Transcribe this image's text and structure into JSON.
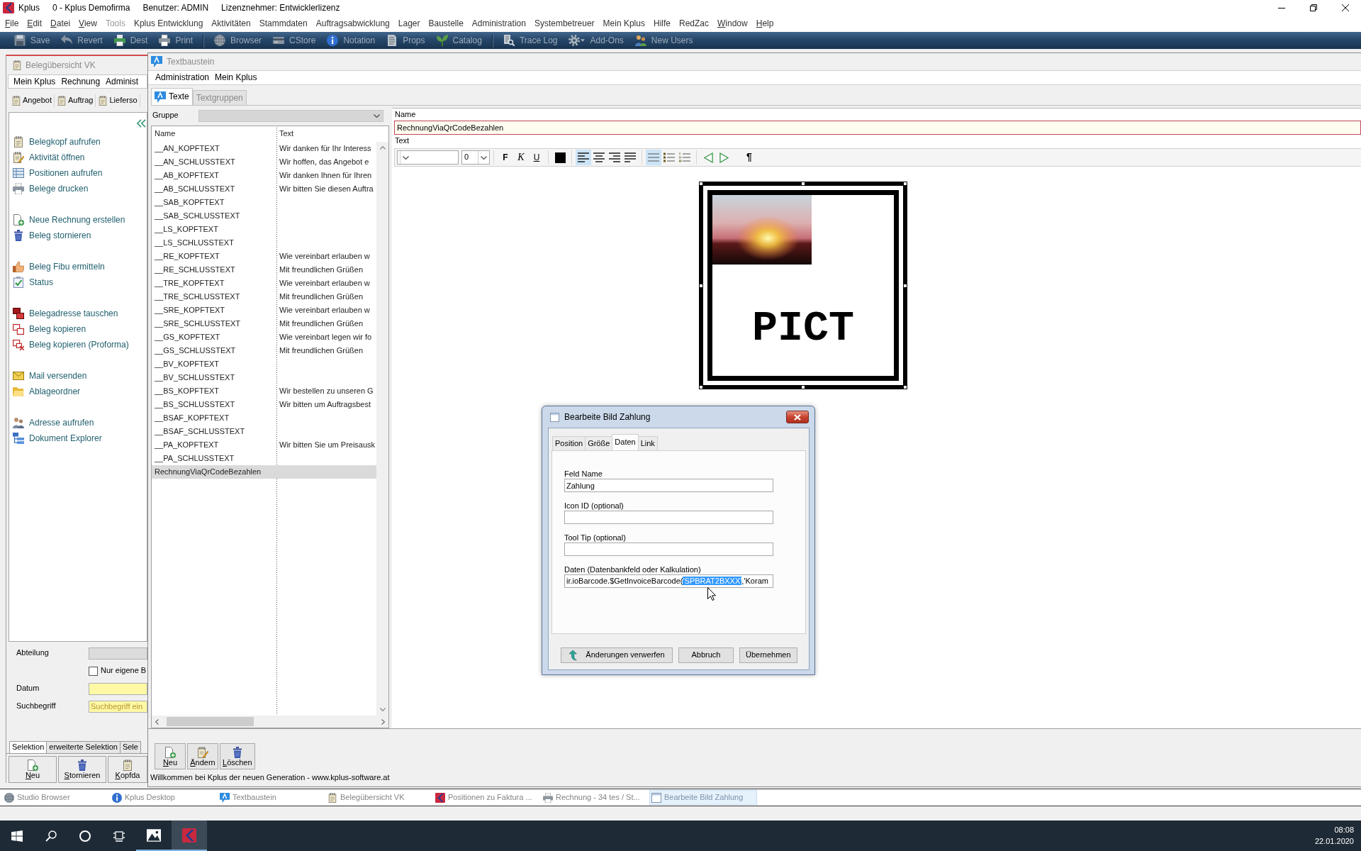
{
  "window": {
    "app_name": "Kplus",
    "title": "0 - Kplus Demofirma",
    "user": "Benutzer: ADMIN",
    "license": "Lizenznehmer: Entwicklerlizenz"
  },
  "menu_bar": [
    {
      "label": "File",
      "dimmed": false,
      "mnemonic": true
    },
    {
      "label": "Edit",
      "dimmed": false,
      "mnemonic": true
    },
    {
      "label": "Datei",
      "dimmed": false,
      "mnemonic": true
    },
    {
      "label": "View",
      "dimmed": false,
      "mnemonic": true
    },
    {
      "label": "Tools",
      "dimmed": true,
      "mnemonic": false
    },
    {
      "label": "Kplus Entwicklung",
      "dimmed": false,
      "mnemonic": false
    },
    {
      "label": "Aktivitäten",
      "dimmed": false,
      "mnemonic": false
    },
    {
      "label": "Stammdaten",
      "dimmed": false,
      "mnemonic": false
    },
    {
      "label": "Auftragsabwicklung",
      "dimmed": false,
      "mnemonic": false
    },
    {
      "label": "Lager",
      "dimmed": false,
      "mnemonic": false
    },
    {
      "label": "Baustelle",
      "dimmed": false,
      "mnemonic": false
    },
    {
      "label": "Administration",
      "dimmed": false,
      "mnemonic": false
    },
    {
      "label": "Systembetreuer",
      "dimmed": false,
      "mnemonic": false
    },
    {
      "label": "Mein Kplus",
      "dimmed": false,
      "mnemonic": false
    },
    {
      "label": "Hilfe",
      "dimmed": false,
      "mnemonic": false
    },
    {
      "label": "RedZac",
      "dimmed": false,
      "mnemonic": false
    },
    {
      "label": "Window",
      "dimmed": false,
      "mnemonic": true
    },
    {
      "label": "Help",
      "dimmed": false,
      "mnemonic": true
    }
  ],
  "toolbar": {
    "groups": [
      {
        "items": [
          {
            "label": "Save",
            "dropdown": false
          },
          {
            "label": "Revert",
            "dropdown": false
          },
          {
            "label": "Dest",
            "dropdown": false
          },
          {
            "label": "Print",
            "dropdown": false
          }
        ]
      },
      {
        "items": [
          {
            "label": "Browser",
            "dropdown": false
          },
          {
            "label": "CStore",
            "dropdown": false
          },
          {
            "label": "Notation",
            "dropdown": false
          },
          {
            "label": "Props",
            "dropdown": false
          },
          {
            "label": "Catalog",
            "dropdown": false
          }
        ]
      },
      {
        "items": [
          {
            "label": "Trace Log",
            "dropdown": false
          },
          {
            "label": "Add-Ons",
            "dropdown": true
          },
          {
            "label": "New Users",
            "dropdown": false
          }
        ]
      }
    ]
  },
  "document_overview": {
    "title": "Belegübersicht VK",
    "menu": [
      "Mein Kplus",
      "Rechnung",
      "Administ"
    ],
    "toolbar": [
      "Angebot",
      "Auftrag",
      "Lieferso"
    ],
    "action_groups": [
      {
        "items": [
          "Belegkopf aufrufen",
          "Aktivität öffnen",
          "Positionen aufrufen",
          "Belege drucken"
        ]
      },
      {
        "items": [
          "Neue Rechnung erstellen",
          "Beleg stornieren"
        ]
      },
      {
        "items": [
          "Beleg Fibu ermitteln",
          "Status"
        ]
      },
      {
        "items": [
          "Belegadresse tauschen",
          "Beleg kopieren",
          "Beleg kopieren (Proforma)"
        ]
      },
      {
        "items": [
          "Mail versenden",
          "Ablageordner"
        ]
      },
      {
        "items": [
          "Adresse aufrufen",
          "Dokument Explorer"
        ]
      }
    ],
    "department_label": "Abteilung",
    "own_only": {
      "label": "Nur eigene B",
      "checked": false
    },
    "date_label": "Datum",
    "search": {
      "label": "Suchbegriff",
      "placeholder": "Suchbegriff ein"
    },
    "tabs": [
      {
        "label": "Selektion",
        "selected": true
      },
      {
        "label": "erweiterte Selektion",
        "selected": false
      },
      {
        "label": "Sele",
        "selected": false
      }
    ],
    "buttons": [
      "Neu",
      "Stornieren",
      "Kopfda"
    ]
  },
  "text_modules": {
    "title": "Textbaustein",
    "menu": [
      "Administration",
      "Mein Kplus"
    ],
    "tabs": [
      {
        "label": "Texte",
        "selected": true
      },
      {
        "label": "Textgruppen",
        "selected": false
      }
    ],
    "group_label": "Gruppe",
    "table": {
      "columns": [
        "Name",
        "Text"
      ],
      "rows": [
        {
          "name": "__AN_KOPFTEXT",
          "text": "Wir danken für Ihr Interess",
          "selected": false
        },
        {
          "name": "__AN_SCHLUSSTEXT",
          "text": "Wir hoffen, das Angebot e",
          "selected": false
        },
        {
          "name": "__AB_KOPFTEXT",
          "text": "Wir danken Ihnen für Ihren",
          "selected": false
        },
        {
          "name": "__AB_SCHLUSSTEXT",
          "text": "Wir bitten Sie diesen Auftra",
          "selected": false
        },
        {
          "name": "__SAB_KOPFTEXT",
          "selected": false
        },
        {
          "name": "__SAB_SCHLUSSTEXT",
          "selected": false
        },
        {
          "name": "__LS_KOPFTEXT",
          "selected": false
        },
        {
          "name": "__LS_SCHLUSSTEXT",
          "selected": false
        },
        {
          "name": "__RE_KOPFTEXT",
          "text": "Wie vereinbart erlauben w",
          "selected": false
        },
        {
          "name": "__RE_SCHLUSSTEXT",
          "text": "Mit freundlichen Grüßen",
          "selected": false
        },
        {
          "name": "__TRE_KOPFTEXT",
          "text": "Wie vereinbart erlauben w",
          "selected": false
        },
        {
          "name": "__TRE_SCHLUSSTEXT",
          "text": "Mit freundlichen Grüßen",
          "selected": false
        },
        {
          "name": "__SRE_KOPFTEXT",
          "text": "Wie vereinbart erlauben w",
          "selected": false
        },
        {
          "name": "__SRE_SCHLUSSTEXT",
          "text": "Mit freundlichen Grüßen",
          "selected": false
        },
        {
          "name": "__GS_KOPFTEXT",
          "text": "Wie vereinbart legen wir fo",
          "selected": false
        },
        {
          "name": "__GS_SCHLUSSTEXT",
          "text": "Mit freundlichen Grüßen",
          "selected": false
        },
        {
          "name": "__BV_KOPFTEXT",
          "selected": false
        },
        {
          "name": "__BV_SCHLUSSTEXT",
          "selected": false
        },
        {
          "name": "__BS_KOPFTEXT",
          "text": "Wir bestellen zu unseren G",
          "selected": false
        },
        {
          "name": "__BS_SCHLUSSTEXT",
          "text": "Wir bitten um Auftragsbest",
          "selected": false
        },
        {
          "name": "__BSAF_KOPFTEXT",
          "selected": false
        },
        {
          "name": "__BSAF_SCHLUSSTEXT",
          "selected": false
        },
        {
          "name": "__PA_KOPFTEXT",
          "text": "Wir bitten Sie um Preisausk",
          "selected": false
        },
        {
          "name": "__PA_SCHLUSSTEXT",
          "selected": false
        },
        {
          "name": "RechnungViaQrCodeBezahlen",
          "selected": true
        }
      ]
    },
    "name_label": "Name",
    "name_value": "RechnungViaQrCodeBezahlen",
    "text_label": "Text",
    "editor_toolbar": {
      "font_size": "0",
      "styles": [
        {
          "kind": "bold",
          "label": "F"
        },
        {
          "kind": "italic",
          "label": "K"
        },
        {
          "kind": "underline",
          "label": "U"
        }
      ],
      "alignment": [
        {
          "kind": "left",
          "selected": true
        },
        {
          "kind": "center",
          "selected": false
        },
        {
          "kind": "right",
          "selected": false
        },
        {
          "kind": "justify",
          "selected": false
        }
      ],
      "list_style": [
        {
          "kind": "none",
          "selected": true
        },
        {
          "kind": "bullet",
          "selected": false
        },
        {
          "kind": "number",
          "selected": false
        }
      ],
      "paragraph_mark": "¶"
    },
    "image_label": "PICT",
    "buttons": [
      "Neu",
      "Ändern",
      "Löschen"
    ],
    "status": "Willkommen bei Kplus der neuen Generation - www.kplus-software.at"
  },
  "dialog": {
    "title": "Bearbeite Bild Zahlung",
    "tabs": [
      {
        "label": "Position",
        "selected": false
      },
      {
        "label": "Größe",
        "selected": false
      },
      {
        "label": "Daten",
        "selected": true
      },
      {
        "label": "Link",
        "selected": false
      }
    ],
    "fields": [
      {
        "label": "Feld Name",
        "value": "Zahlung"
      },
      {
        "label": "Icon ID (optional)"
      },
      {
        "label": "Tool Tip (optional)"
      },
      {
        "label": "Daten (Datenbankfeld oder Kalkulation)",
        "value_parts": [
          {
            "text": "ir.ioBarcode.$GetInvoiceBarcode(",
            "selected": false
          },
          {
            "text": "'SPBRAT2BXXX'",
            "selected": true
          },
          {
            "text": ",'Koram",
            "selected": false
          }
        ]
      }
    ],
    "buttons": [
      {
        "label": "Änderungen verwerfen",
        "kind": "revert"
      },
      {
        "label": "Abbruch",
        "kind": "plain"
      },
      {
        "label": "Übernehmen",
        "kind": "plain"
      }
    ]
  },
  "window_list": [
    {
      "label": "Studio Browser",
      "selected": false
    },
    {
      "label": "Kplus Desktop",
      "selected": false
    },
    {
      "label": "Textbaustein",
      "selected": false
    },
    {
      "label": "Belegübersicht VK",
      "selected": false
    },
    {
      "label": "Positionen zu Faktura ...",
      "selected": false
    },
    {
      "label": "Rechnung - 34 tes / St...",
      "selected": false
    },
    {
      "label": "Bearbeite Bild Zahlung",
      "selected": true
    }
  ],
  "taskbar": {
    "apps": [
      {
        "active": false
      },
      {
        "active": true
      }
    ],
    "time": "08:08",
    "date": "22.01.2020"
  }
}
